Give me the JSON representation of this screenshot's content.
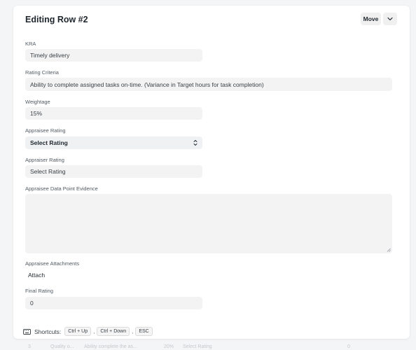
{
  "dialog": {
    "title": "Editing Row #2",
    "move_label": "Move"
  },
  "fields": {
    "kra": {
      "label": "KRA",
      "value": "Timely delivery"
    },
    "rating_criteria": {
      "label": "Rating Criteria",
      "value": "Ability to complete assigned tasks on-time. (Variance in Target hours for task completion)"
    },
    "weightage": {
      "label": "Weightage",
      "value": "15%"
    },
    "appraisee_rating": {
      "label": "Appraisee Rating",
      "value": "Select Rating"
    },
    "appraiser_rating": {
      "label": "Appraiser Rating",
      "value": "Select Rating"
    },
    "evidence": {
      "label": "Appraisee Data Point Evidence",
      "value": ""
    },
    "attachments": {
      "label": "Appraisee Attachments",
      "button": "Attach"
    },
    "final_rating": {
      "label": "Final Rating",
      "value": "0"
    }
  },
  "shortcuts": {
    "label": "Shortcuts:",
    "keys": [
      "Ctrl + Up",
      "Ctrl + Down",
      "ESC"
    ],
    "separator": ","
  },
  "background_row": {
    "index": "3",
    "kra": "Quality o...",
    "criteria": "Ability complete the as...",
    "weightage": "20%",
    "rating": "Select Rating",
    "final": "0"
  },
  "icons": {
    "chevron": "chevron-down-icon",
    "select": "select-arrows-icon",
    "keyboard": "keyboard-icon",
    "resize": "resize-grip-icon"
  }
}
